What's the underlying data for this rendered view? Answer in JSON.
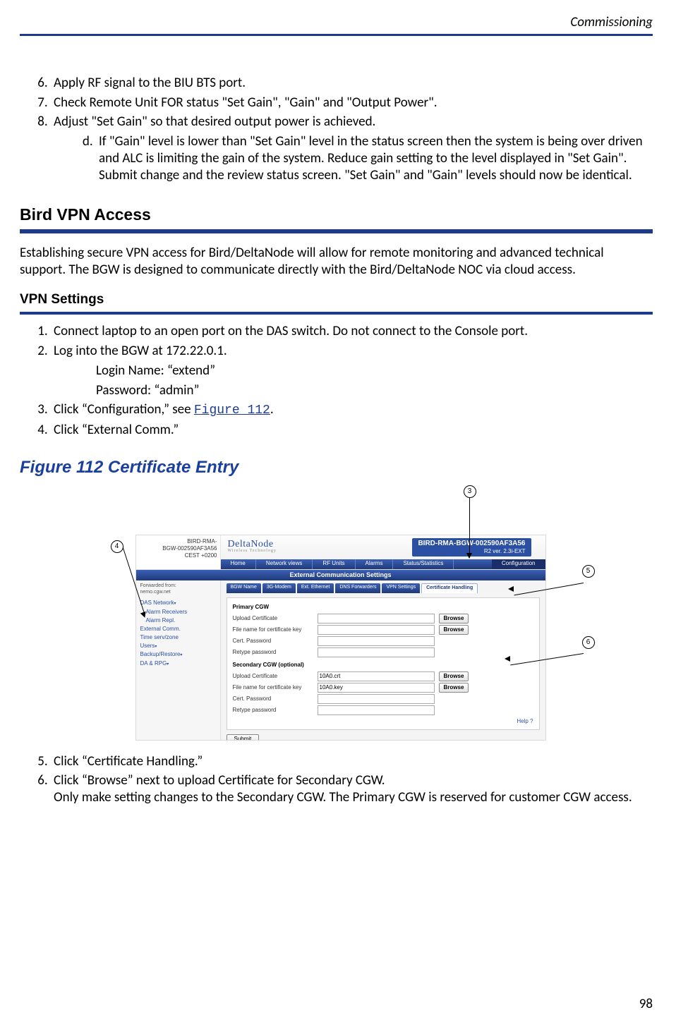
{
  "header": {
    "running_head": "Commissioning"
  },
  "list_top": {
    "items": [
      {
        "num": "6.",
        "text": "Apply RF signal to the BIU BTS port."
      },
      {
        "num": "7.",
        "text": "Check Remote Unit FOR status \"Set Gain\", \"Gain\" and \"Output Power\"."
      },
      {
        "num": "8.",
        "text": "Adjust \"Set Gain\" so that desired output power is achieved."
      }
    ],
    "sub8": {
      "letter": "d.",
      "text": "If \"Gain\" level is lower than \"Set Gain\" level in the status screen then the system is being over driven and ALC is limiting the gain of the system.  Reduce gain setting to the level displayed in \"Set Gain\".  Submit change and the review status screen.  \"Set Gain\" and \"Gain\" levels should now be identical."
    }
  },
  "h2_vpn": "Bird VPN Access",
  "vpn_intro": "Establishing secure VPN access for Bird/DeltaNode will allow for remote monitoring and advanced technical support. The BGW is designed to communicate directly with the Bird/DeltaNode NOC via cloud access.",
  "h3_settings": "VPN Settings",
  "list_vpn": {
    "items": [
      {
        "num": "1.",
        "text": "Connect laptop to an open port on the DAS switch. Do not connect to the Console port."
      },
      {
        "num": "2.",
        "text": "Log into the BGW at 172.22.0.1."
      },
      {
        "num": "3.",
        "pre": "Click “Configuration,” see ",
        "link": "Figure 112",
        "post": "."
      },
      {
        "num": "4.",
        "text": "Click “External Comm.”"
      }
    ],
    "creds": {
      "login_line": "Login Name: “extend”",
      "pass_line": "Password: “admin”"
    }
  },
  "fig_caption": "Figure 112    Certificate Entry",
  "callouts": {
    "c3": "3",
    "c4": "4",
    "c5": "5",
    "c6": "6"
  },
  "mini": {
    "left_head": {
      "l1": "BIRD-RMA-",
      "l2": "BGW-002590AF3A56",
      "l3": "CEST +0200"
    },
    "brand": "DeltaNode",
    "brand_sub": "Wireless Technology",
    "title1": "BIRD-RMA-BGW-002590AF3A56",
    "title2": "R2 ver. 2.3i-EXT",
    "nav": [
      "Home",
      "Network views",
      "RF Units",
      "Alarms",
      "Status/Statistics",
      "Configuration"
    ],
    "banner": "External Communication Settings",
    "sidebar_fwd1": "Forwarded from:",
    "sidebar_fwd2": "nemo.cgw.net",
    "sidebar_items": [
      "DAS Network",
      "Alarm Receivers",
      "Alarm Repl.",
      "External Comm.",
      "Time serv/zone",
      "Users",
      "Backup/Restore",
      "DA & RPG"
    ],
    "tabs": [
      "BGW Name",
      "3G-Modem",
      "Ext. Ethernet",
      "DNS Forwarders",
      "VPN Settings",
      "Certificate Handling"
    ],
    "grp1": "Primary CGW",
    "grp2": "Secondary CGW (optional)",
    "lbl_upload": "Upload Certificate",
    "lbl_file": "File name for certificate key",
    "lbl_cert_pw": "Cert. Password",
    "lbl_retype": "Retype password",
    "browse": "Browse",
    "val_sec_upload": "10A0.crt",
    "val_sec_file": "10A0.key",
    "submit": "Submit",
    "help": "Help ?"
  },
  "list_bottom": {
    "items": [
      {
        "num": "5.",
        "text": "Click “Certificate Handling.”"
      },
      {
        "num": "6.",
        "l1": "Click “Browse” next to upload Certificate for Secondary CGW.",
        "l2": "Only make setting changes to the Secondary CGW. The Primary CGW is reserved for customer CGW access."
      }
    ]
  },
  "page_number": "98"
}
